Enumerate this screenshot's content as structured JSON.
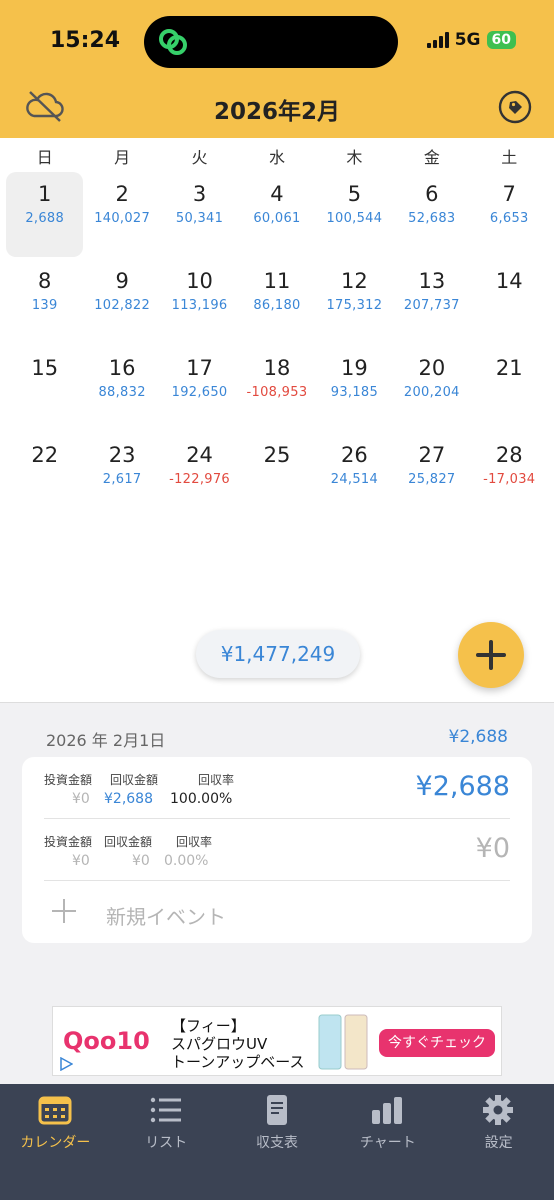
{
  "status_bar": {
    "time": "15:24",
    "network": "5G",
    "battery": "60"
  },
  "nav": {
    "title": "2026年2月",
    "left_icon": "cloud-off-icon",
    "right_icon": "tag-icon"
  },
  "calendar": {
    "weekdays": [
      "日",
      "月",
      "火",
      "水",
      "木",
      "金",
      "土"
    ],
    "selected_day": "1",
    "weeks": [
      [
        {
          "day": "1",
          "value": "2,688",
          "kind": "pos"
        },
        {
          "day": "2",
          "value": "140,027",
          "kind": "pos"
        },
        {
          "day": "3",
          "value": "50,341",
          "kind": "pos"
        },
        {
          "day": "4",
          "value": "60,061",
          "kind": "pos"
        },
        {
          "day": "5",
          "value": "100,544",
          "kind": "pos"
        },
        {
          "day": "6",
          "value": "52,683",
          "kind": "pos"
        },
        {
          "day": "7",
          "value": "6,653",
          "kind": "pos"
        }
      ],
      [
        {
          "day": "8",
          "value": "139",
          "kind": "pos"
        },
        {
          "day": "9",
          "value": "102,822",
          "kind": "pos"
        },
        {
          "day": "10",
          "value": "113,196",
          "kind": "pos"
        },
        {
          "day": "11",
          "value": "86,180",
          "kind": "pos"
        },
        {
          "day": "12",
          "value": "175,312",
          "kind": "pos"
        },
        {
          "day": "13",
          "value": "207,737",
          "kind": "pos"
        },
        {
          "day": "14",
          "value": "",
          "kind": "pos"
        }
      ],
      [
        {
          "day": "15",
          "value": "",
          "kind": "pos"
        },
        {
          "day": "16",
          "value": "88,832",
          "kind": "pos"
        },
        {
          "day": "17",
          "value": "192,650",
          "kind": "pos"
        },
        {
          "day": "18",
          "value": "-108,953",
          "kind": "neg"
        },
        {
          "day": "19",
          "value": "93,185",
          "kind": "pos"
        },
        {
          "day": "20",
          "value": "200,204",
          "kind": "pos"
        },
        {
          "day": "21",
          "value": "",
          "kind": "pos"
        }
      ],
      [
        {
          "day": "22",
          "value": "",
          "kind": "pos"
        },
        {
          "day": "23",
          "value": "2,617",
          "kind": "pos"
        },
        {
          "day": "24",
          "value": "-122,976",
          "kind": "neg"
        },
        {
          "day": "25",
          "value": "",
          "kind": "pos"
        },
        {
          "day": "26",
          "value": "24,514",
          "kind": "pos"
        },
        {
          "day": "27",
          "value": "25,827",
          "kind": "pos"
        },
        {
          "day": "28",
          "value": "-17,034",
          "kind": "neg"
        }
      ]
    ]
  },
  "total": "¥1,477,249",
  "fab_icon": "plus-icon",
  "detail": {
    "date": "2026 年 2月1日",
    "day_total": "¥2,688",
    "label_invest": "投資金額",
    "label_return": "回収金額",
    "label_rate": "回収率",
    "entries": [
      {
        "invest": "¥0",
        "return": "¥2,688",
        "rate": "100.00%",
        "total": "¥2,688"
      },
      {
        "invest": "¥0",
        "return": "¥0",
        "rate": "0.00%",
        "total": "¥0"
      }
    ],
    "new_event": "新規イベント"
  },
  "ad": {
    "brand": "Qoo10",
    "line1": "【フィー】",
    "line2": "スパグロウUV",
    "line3": "トーンアップベース",
    "cta": "今すぐチェック"
  },
  "tabs": [
    {
      "label": "カレンダー",
      "icon": "calendar-icon",
      "active": true
    },
    {
      "label": "リスト",
      "icon": "list-icon",
      "active": false
    },
    {
      "label": "収支表",
      "icon": "document-icon",
      "active": false
    },
    {
      "label": "チャート",
      "icon": "bar-chart-icon",
      "active": false
    },
    {
      "label": "設定",
      "icon": "gear-icon",
      "active": false
    }
  ],
  "colors": {
    "accent": "#f5c14b",
    "positive": "#3a86d6",
    "negative": "#e24a3f",
    "tabbar": "#3b4354"
  }
}
